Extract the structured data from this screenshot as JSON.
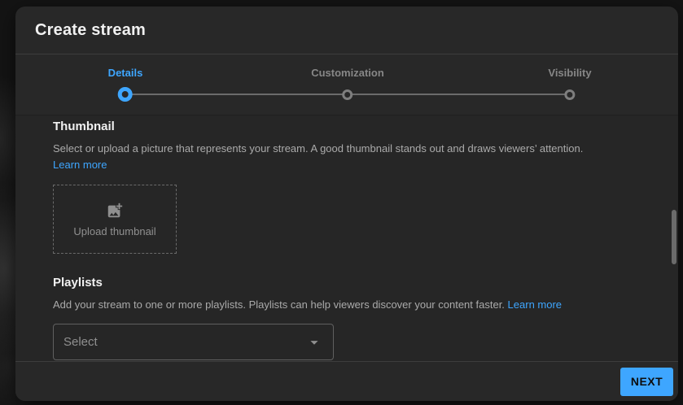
{
  "dialog": {
    "title": "Create stream",
    "stepper": {
      "active_step": "Details",
      "steps": [
        {
          "label": "Details"
        },
        {
          "label": "Customization"
        },
        {
          "label": "Visibility"
        }
      ]
    },
    "thumbnail_section": {
      "heading": "Thumbnail",
      "description": "Select or upload a picture that represents your stream. A good thumbnail stands out and draws viewers’ attention.",
      "learn_more_label": "Learn more",
      "upload_button_label": "Upload thumbnail"
    },
    "playlists_section": {
      "heading": "Playlists",
      "description": "Add your stream to one or more playlists. Playlists can help viewers discover your content faster.",
      "learn_more_label": "Learn more",
      "select_value": "Select"
    },
    "footer": {
      "next_button_label": "NEXT"
    },
    "icons": {
      "upload": "add-photo-icon",
      "select": "caret-down-icon"
    },
    "colors": {
      "accent_blue": "#3ea6ff",
      "dialog_background": "#282828",
      "content_background": "#262626",
      "heading_text": "#f1f1f1",
      "body_text": "#aaaaaa",
      "muted_text": "#909090",
      "next_button_text": "#0d0d0d",
      "scrollbar_thumb": "#6b6b6b"
    }
  }
}
